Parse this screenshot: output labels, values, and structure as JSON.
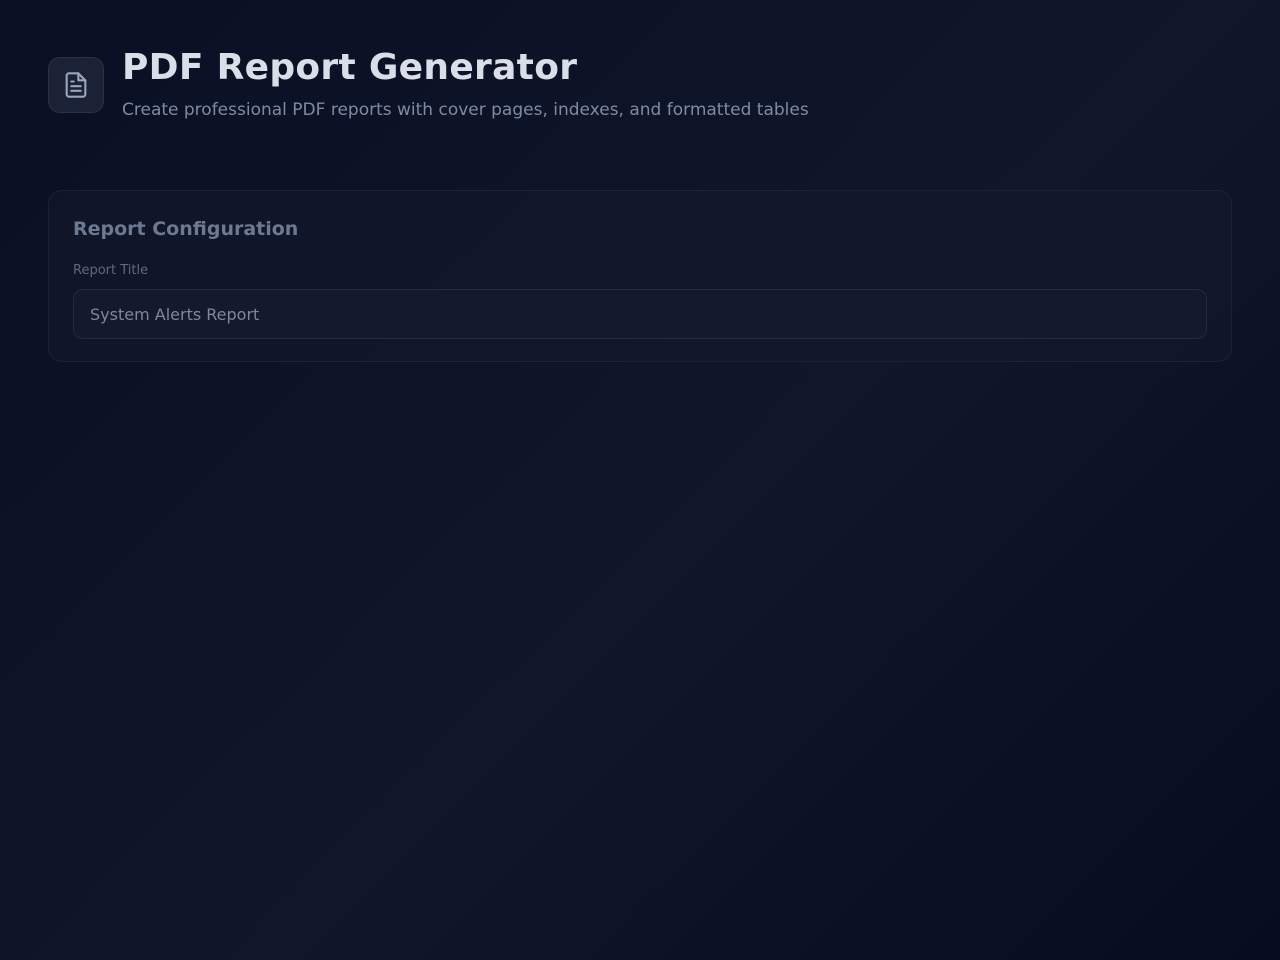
{
  "header": {
    "logo_icon": "document-icon",
    "title": "PDF Report Generator",
    "subtitle": "Create professional PDF reports with cover pages, indexes, and formatted tables"
  },
  "config": {
    "title": "Report Configuration",
    "report_title_label": "Report Title",
    "report_title_value": "System Alerts Report"
  },
  "colors": {
    "background": "#0e1428",
    "title_text": "#d9dee8",
    "muted_text": "#7f8aa1"
  }
}
